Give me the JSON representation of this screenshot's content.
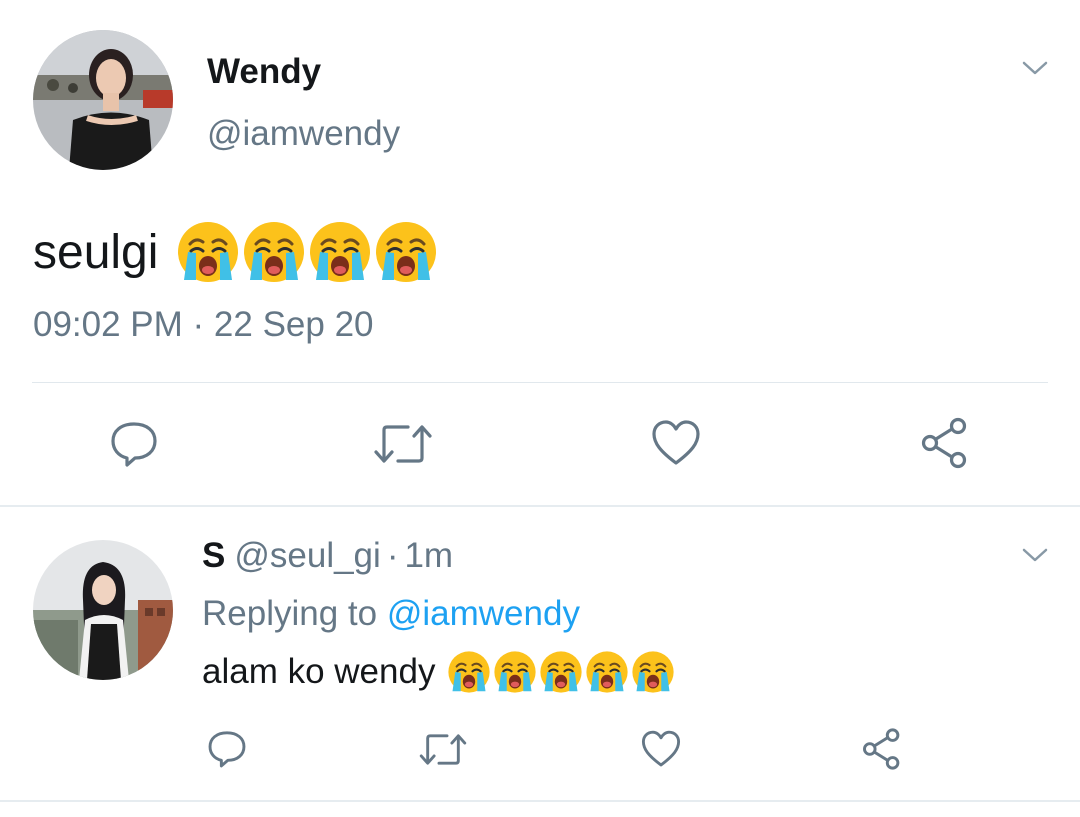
{
  "main_tweet": {
    "display_name": "Wendy",
    "handle": "@iamwendy",
    "text": "seulgi",
    "emojis": [
      "loudly-crying-face",
      "loudly-crying-face",
      "loudly-crying-face",
      "loudly-crying-face"
    ],
    "timestamp": "09:02 PM · 22 Sep 20",
    "actions": [
      "reply-icon",
      "retweet-icon",
      "like-icon",
      "share-icon"
    ],
    "menu_icon": "chevron-down-icon"
  },
  "reply_tweet": {
    "display_name": "S",
    "handle": "@seul_gi",
    "separator": "·",
    "time": "1m",
    "replying_prefix": "Replying to",
    "replying_to": "@iamwendy",
    "text": "alam ko wendy",
    "emojis": [
      "loudly-crying-face",
      "loudly-crying-face",
      "loudly-crying-face",
      "loudly-crying-face",
      "loudly-crying-face"
    ],
    "actions": [
      "reply-icon",
      "retweet-icon",
      "like-icon",
      "share-icon"
    ],
    "menu_icon": "chevron-down-icon"
  },
  "colors": {
    "text_primary": "#14171a",
    "text_secondary": "#657786",
    "link_blue": "#1da1f2",
    "divider": "#e1e8ed"
  }
}
